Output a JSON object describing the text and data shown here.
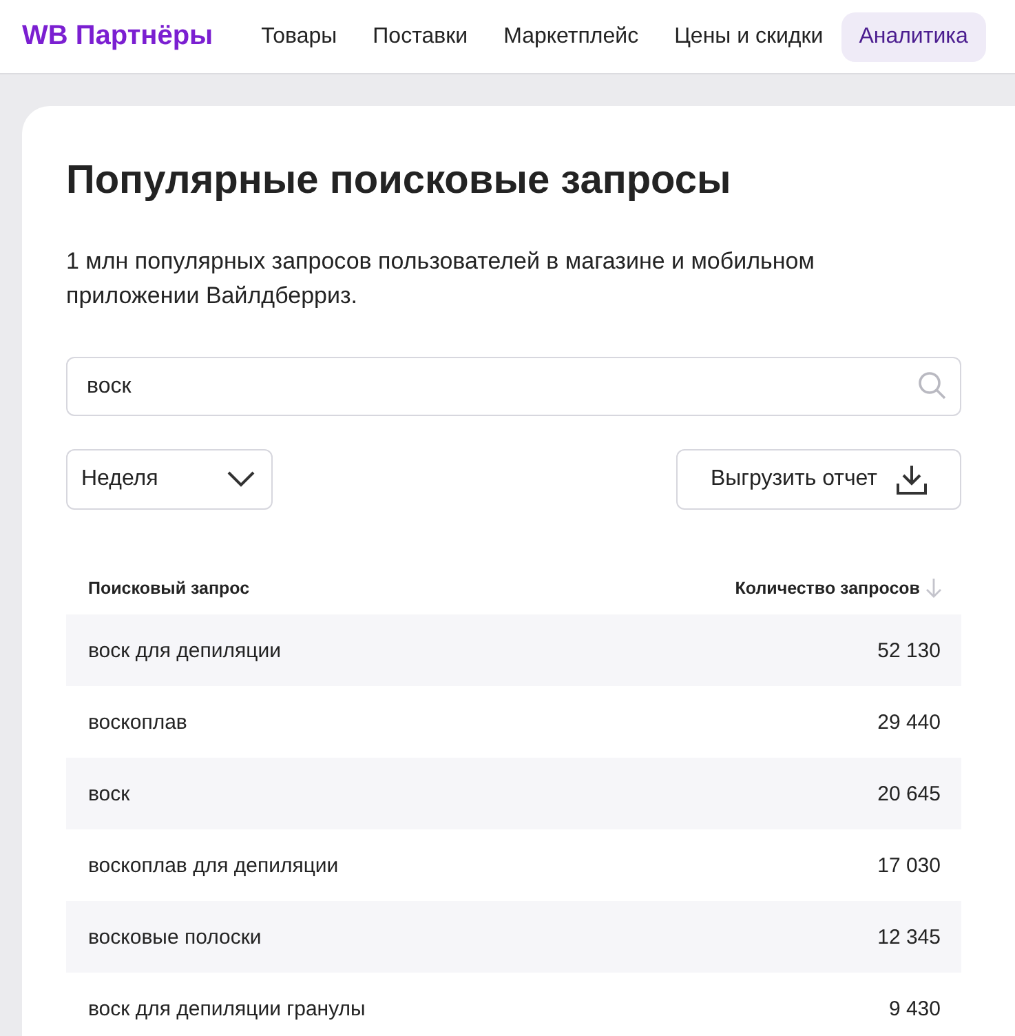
{
  "header": {
    "logo": "WB Партнёры",
    "nav": [
      {
        "label": "Товары",
        "selected": false
      },
      {
        "label": "Поставки",
        "selected": false
      },
      {
        "label": "Маркетплейс",
        "selected": false
      },
      {
        "label": "Цены и скидки",
        "selected": false
      },
      {
        "label": "Аналитика",
        "selected": true
      }
    ]
  },
  "page": {
    "title": "Популярные поисковые запросы",
    "description": "1 млн популярных запросов пользователей в магазине и мобильном приложении Вайлдберриз.",
    "search": {
      "value": "воск"
    },
    "period": {
      "value": "Неделя"
    },
    "export_button": "Выгрузить отчет"
  },
  "table": {
    "columns": [
      {
        "label": "Поисковый запрос",
        "sorted": false
      },
      {
        "label": "Количество запросов",
        "sorted": true
      }
    ],
    "rows": [
      {
        "query": "воск для депиляции",
        "count": "52 130"
      },
      {
        "query": "воскоплав",
        "count": "29 440"
      },
      {
        "query": "воск",
        "count": "20 645"
      },
      {
        "query": "воскоплав для депиляции",
        "count": "17 030"
      },
      {
        "query": "восковые полоски",
        "count": "12 345"
      },
      {
        "query": "воск для депиляции гранулы",
        "count": "9 430"
      }
    ]
  }
}
